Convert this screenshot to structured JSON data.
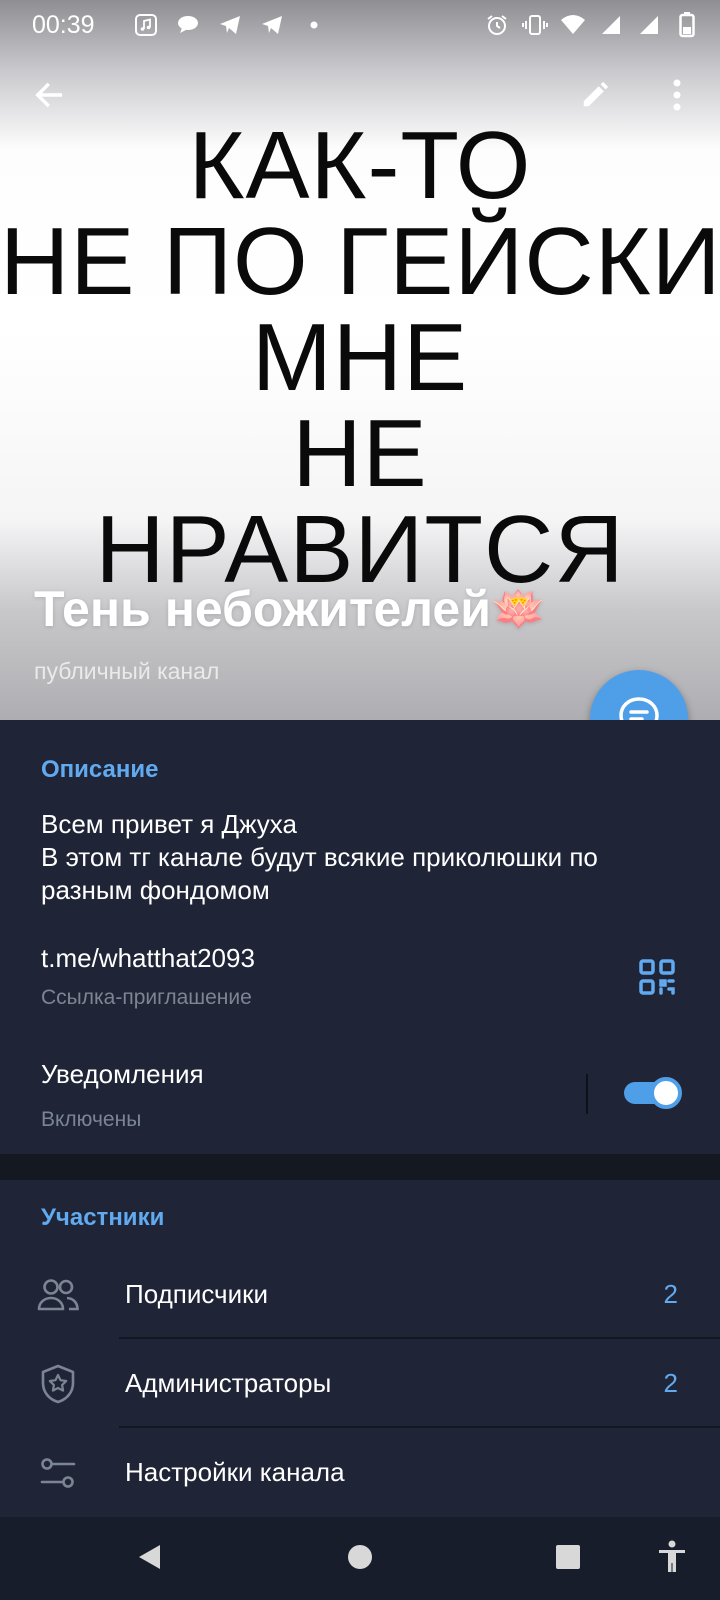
{
  "status_bar": {
    "time": "00:39",
    "left_icons": [
      "music-app-icon",
      "chat-bubble-icon",
      "telegram-icon",
      "telegram-icon",
      "dot-icon"
    ],
    "right_icons": [
      "alarm-icon",
      "vibrate-icon",
      "wifi-icon",
      "signal-icon",
      "signal-icon",
      "battery-icon"
    ]
  },
  "cover": {
    "caption_lines": [
      "КАК-ТО",
      "НЕ ПО ГЕЙСКИ,",
      "МНЕ",
      "НЕ",
      "НРАВИТСЯ"
    ]
  },
  "header": {
    "back_icon": "arrow-left-icon",
    "edit_icon": "pencil-icon",
    "more_icon": "dots-vertical-icon",
    "channel_name": "Тень небожителей",
    "channel_emoji": "🪷",
    "channel_type": "публичный канал",
    "fab_icon": "chat-icon"
  },
  "info": {
    "description_title": "Описание",
    "description_text": "Всем привет я Джуха\nВ этом тг канале будут всякие приколюшки по разным фондомом",
    "link": "t.me/whatthat2093",
    "link_caption": "Ссылка-приглашение",
    "qr_icon": "qr-code-icon",
    "notifications_label": "Уведомления",
    "notifications_status": "Включены",
    "notifications_enabled": true
  },
  "members": {
    "title": "Участники",
    "rows": [
      {
        "label": "Подписчики",
        "count": "2",
        "icon": "people-icon"
      },
      {
        "label": "Администраторы",
        "count": "2",
        "icon": "shield-star-icon"
      },
      {
        "label": "Настройки канала",
        "count": "",
        "icon": "sliders-icon"
      }
    ]
  },
  "nav_bar": {
    "buttons": [
      "back-triangle-icon",
      "home-circle-icon",
      "recents-square-icon",
      "accessibility-icon"
    ]
  },
  "colors": {
    "accent": "#62aaf0",
    "fab": "#4f9fe8",
    "background": "#1f2536",
    "secondary_text": "#7c8593"
  }
}
